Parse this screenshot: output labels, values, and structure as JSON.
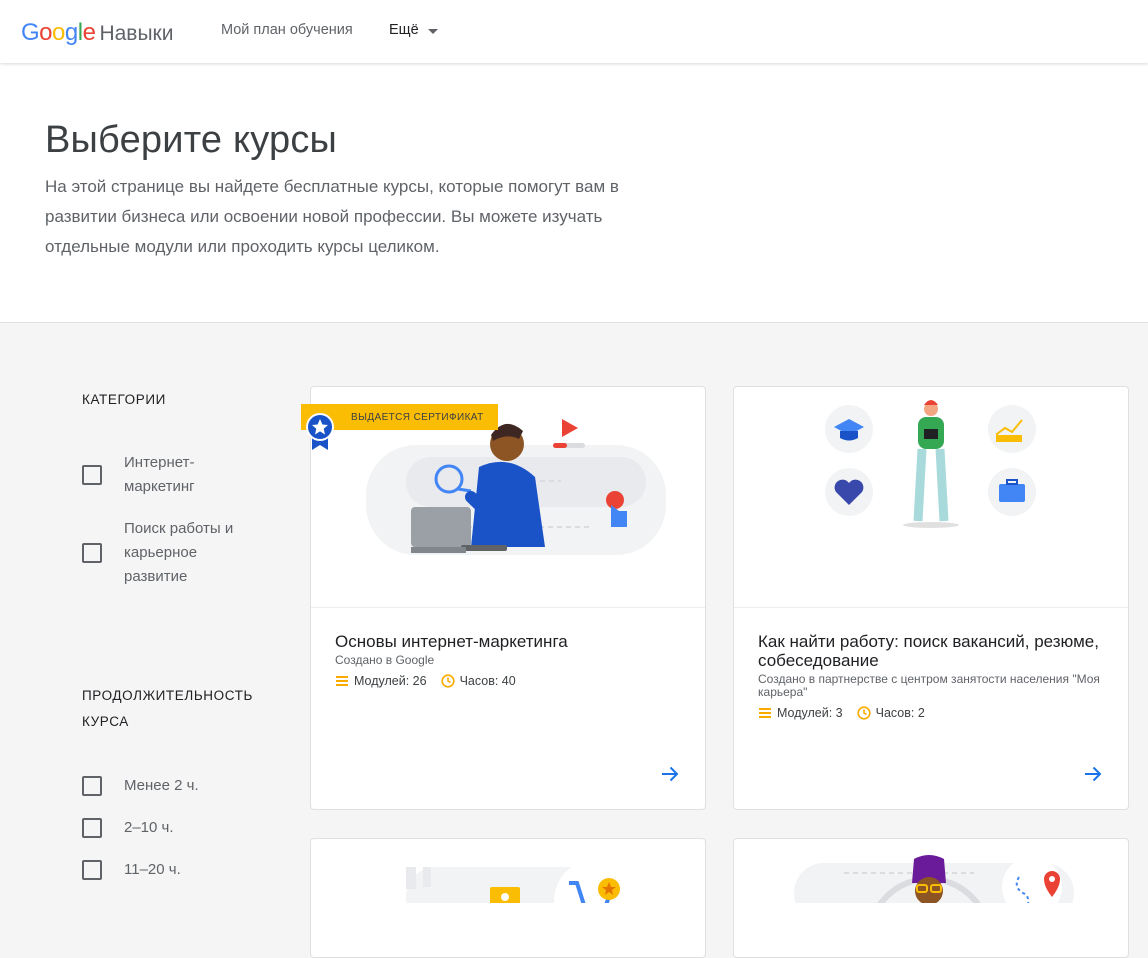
{
  "header": {
    "logo_letters": [
      {
        "ch": "G",
        "color": "#4285F4"
      },
      {
        "ch": "o",
        "color": "#EA4335"
      },
      {
        "ch": "o",
        "color": "#FBBC05"
      },
      {
        "ch": "g",
        "color": "#4285F4"
      },
      {
        "ch": "l",
        "color": "#34A853"
      },
      {
        "ch": "e",
        "color": "#EA4335"
      }
    ],
    "product_name": "Навыки",
    "nav_plan": "Мой план обучения",
    "nav_more": "Ещё"
  },
  "hero": {
    "title": "Выберите курсы",
    "description": "На этой странице вы найдете бесплатные курсы, которые помогут вам в развитии бизнеса или освоении новой профессии. Вы можете изучать отдельные модули или проходить курсы целиком."
  },
  "sidebar": {
    "categories_title": "КАТЕГОРИИ",
    "categories": [
      {
        "label": "Интернет-маркетинг"
      },
      {
        "label": "Поиск работы и карьерное развитие"
      }
    ],
    "duration_title": "ПРОДОЛЖИТЕЛЬНОСТЬ КУРСА",
    "durations": [
      {
        "label": "Менее 2 ч."
      },
      {
        "label": "2–10 ч."
      },
      {
        "label": "11–20 ч."
      }
    ]
  },
  "courses": [
    {
      "badge": "ВЫДАЕТСЯ СЕРТИФИКАТ",
      "title": "Основы интернет-маркетинга",
      "creator": "Создано в Google",
      "modules": "Модулей: 26",
      "hours": "Часов: 40"
    },
    {
      "title": "Как найти работу: поиск вакансий, резюме, собеседование",
      "creator": "Создано в партнерстве с центром занятости населения \"Моя карьера\"",
      "modules": "Модулей: 3",
      "hours": "Часов: 2"
    }
  ],
  "colors": {
    "accent": "#1a73e8",
    "badge": "#fbbc04",
    "meta_icon": "#f9ab00"
  },
  "icons": [
    "caret-down-icon",
    "modules-icon",
    "clock-icon",
    "arrow-right-icon",
    "medal-icon"
  ]
}
